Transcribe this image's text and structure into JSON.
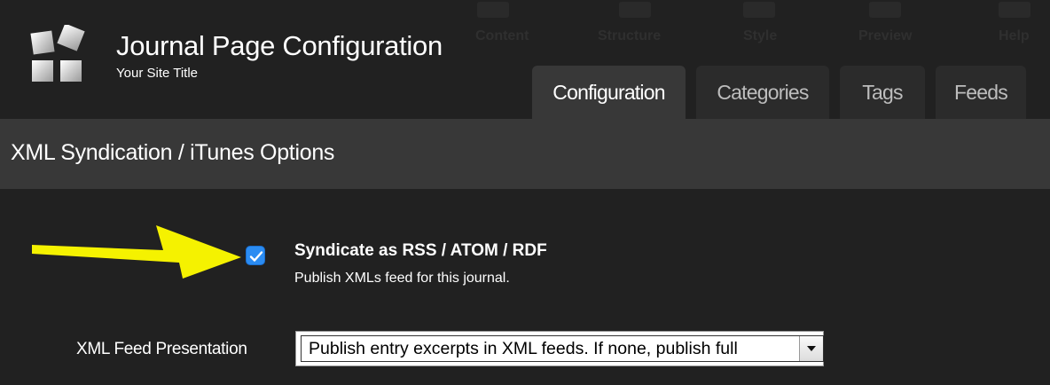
{
  "toolbar_ghost": {
    "items": [
      "Content",
      "Structure",
      "Style",
      "Preview",
      "Help"
    ]
  },
  "header": {
    "logo_icon": "squares-logo-icon",
    "title": "Journal Page Configuration",
    "subtitle": "Your Site Title"
  },
  "tabs": [
    {
      "label": "Configuration",
      "active": true
    },
    {
      "label": "Categories",
      "active": false
    },
    {
      "label": "Tags",
      "active": false
    },
    {
      "label": "Feeds",
      "active": false
    }
  ],
  "section": {
    "title": "XML Syndication / iTunes Options"
  },
  "syndicate": {
    "checked": true,
    "label": "Syndicate as RSS / ATOM / RDF",
    "description": "Publish XMLs feed for this journal."
  },
  "feed_presentation": {
    "label": "XML Feed Presentation",
    "selected": "Publish entry excerpts in XML feeds. If none, publish full"
  },
  "colors": {
    "accent": "#2b8cf2",
    "arrow": "#f5f200",
    "background": "#212121",
    "section_bar": "#383838"
  }
}
